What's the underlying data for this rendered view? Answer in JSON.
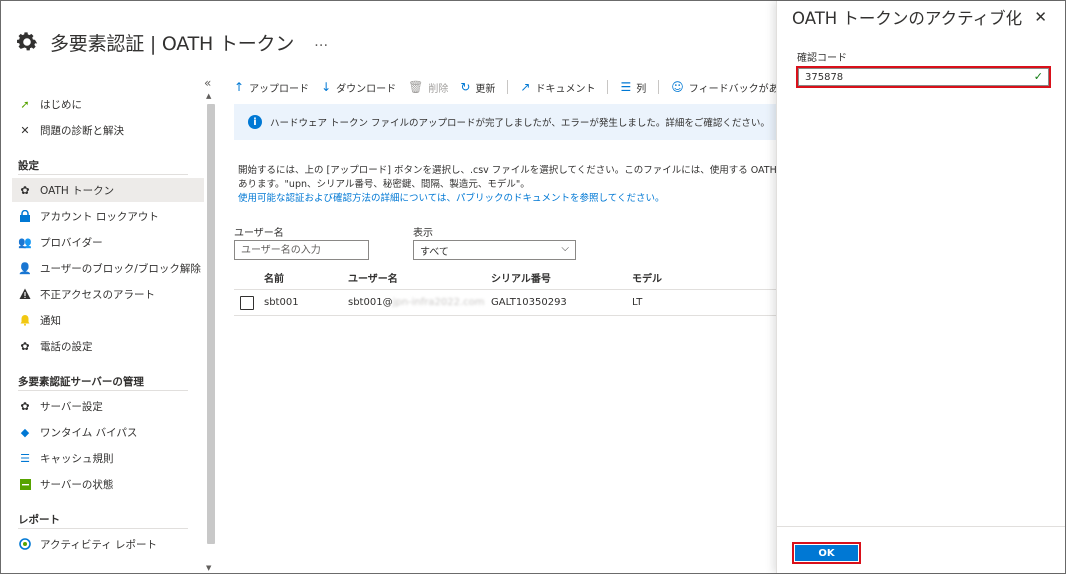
{
  "header": {
    "title": "多要素認証 | OATH トークン",
    "more": "…"
  },
  "sidebar": {
    "collapse": "«",
    "items_top": [
      {
        "label": "はじめに",
        "icon": "rocket-icon"
      },
      {
        "label": "問題の診断と解決",
        "icon": "wrench-icon"
      }
    ],
    "section_settings": "設定",
    "items_settings": [
      {
        "label": "OATH トークン",
        "icon": "gear-icon",
        "active": true
      },
      {
        "label": "アカウント ロックアウト",
        "icon": "lock-icon"
      },
      {
        "label": "プロバイダー",
        "icon": "users-icon"
      },
      {
        "label": "ユーザーのブロック/ブロック解除",
        "icon": "user-block-icon"
      },
      {
        "label": "不正アクセスのアラート",
        "icon": "warning-icon"
      },
      {
        "label": "通知",
        "icon": "bell-icon"
      },
      {
        "label": "電話の設定",
        "icon": "gear-icon"
      }
    ],
    "section_server": "多要素認証サーバーの管理",
    "items_server": [
      {
        "label": "サーバー設定",
        "icon": "gear-icon"
      },
      {
        "label": "ワンタイム バイパス",
        "icon": "diamond-icon"
      },
      {
        "label": "キャッシュ規則",
        "icon": "list-icon"
      },
      {
        "label": "サーバーの状態",
        "icon": "status-icon"
      }
    ],
    "section_report": "レポート",
    "items_report": [
      {
        "label": "アクティビティ レポート",
        "icon": "activity-icon"
      }
    ]
  },
  "toolbar": {
    "upload": "アップロード",
    "download": "ダウンロード",
    "delete": "削除",
    "refresh": "更新",
    "docs": "ドキュメント",
    "columns": "列",
    "feedback": "フィードバックがある場合"
  },
  "banner": {
    "text": "ハードウェア トークン ファイルのアップロードが完了しましたが、エラーが発生しました。詳細をご確認ください。",
    "arrow": "→"
  },
  "description": {
    "line1": "開始するには、上の [アップロード] ボタンを選択し、.csv ファイルを選択してください。このファイルには、使用する OATH トークン用の秘",
    "line2": "あります。\"upn、シリアル番号、秘密鍵、間隔、製造元、モデル\"。",
    "link": "使用可能な認証および確認方法の詳細については、パブリックのドキュメントを参照してください。"
  },
  "filters": {
    "username_label": "ユーザー名",
    "username_placeholder": "ユーザー名の入力",
    "display_label": "表示",
    "display_value": "すべて"
  },
  "table": {
    "headers": {
      "name": "名前",
      "user": "ユーザー名",
      "serial": "シリアル番号",
      "model": "モデル"
    },
    "rows": [
      {
        "name": "sbt001",
        "user_prefix": "sbt001@",
        "user_masked": "jpn-infra2022.com",
        "serial": "GALT10350293",
        "model": "LT"
      }
    ]
  },
  "panel": {
    "title": "OATH トークンのアクティブ化",
    "close": "✕",
    "code_label": "確認コード",
    "code_value": "375878",
    "ok_label": "OK"
  },
  "colors": {
    "accent": "#0078d4",
    "highlight": "#d9101a",
    "banner_bg": "#ebf3fc"
  }
}
